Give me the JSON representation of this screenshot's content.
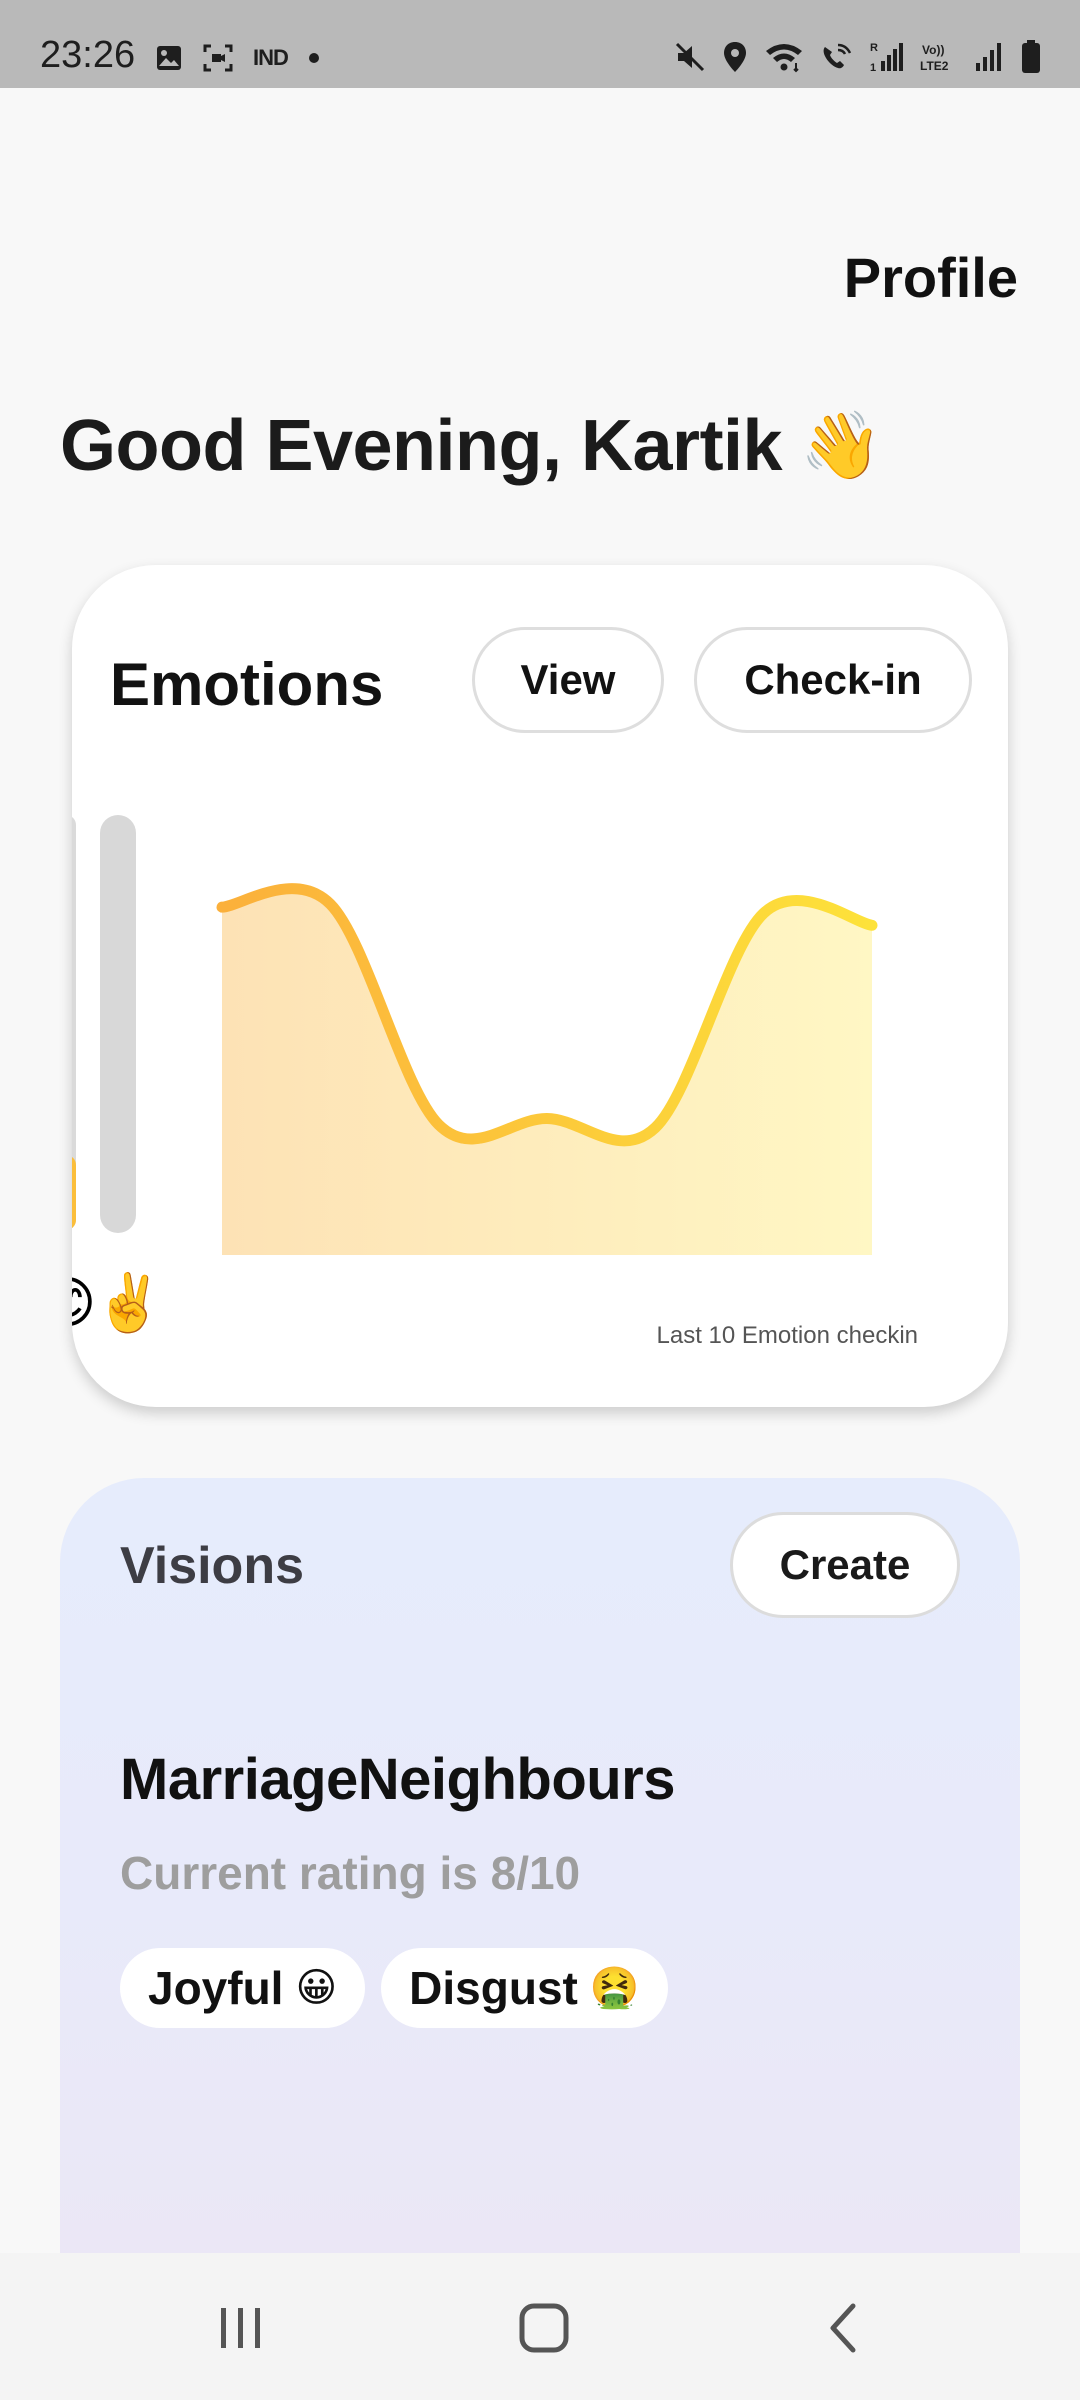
{
  "status_bar": {
    "time": "23:26",
    "left_icons": [
      "image-icon",
      "screen-record-icon",
      "ind-logo-icon",
      "dot-icon"
    ],
    "ind_label": "IND",
    "right_icons": [
      "mute-icon",
      "location-icon",
      "wifi-icon",
      "wifi-call-icon",
      "signal-1-icon",
      "volte-icon",
      "signal-2-icon",
      "battery-icon"
    ],
    "volte_label_1": "Vo))",
    "volte_label_2": "LTE2",
    "r_label": "R",
    "one_label": "1"
  },
  "header": {
    "profile_label": "Profile",
    "greeting": "Good Evening, Kartik",
    "greeting_emoji": "👋"
  },
  "emotions": {
    "title": "Emotions",
    "view_label": "View",
    "checkin_label": "Check-in",
    "partial_emoji": "😊",
    "peace_emoji": "✌️",
    "caption": "Last 10 Emotion checkin",
    "colors": {
      "line_start": "#fbb03b",
      "line_end": "#fde23a",
      "fill_start": "#fde2b5",
      "fill_end": "#fff7c4"
    },
    "trend_levels": [
      0.92,
      0.93,
      0.2,
      0.22,
      0.19,
      0.9,
      0.86
    ]
  },
  "visions": {
    "title": "Visions",
    "create_label": "Create",
    "vision_name": "MarriageNeighbours",
    "rating_text": "Current rating is 8/10",
    "tags": [
      {
        "label": "Joyful",
        "emoji": "😀"
      },
      {
        "label": "Disgust",
        "emoji": "🤮"
      }
    ]
  },
  "nav": {
    "icons": [
      "recent-apps-icon",
      "home-icon",
      "back-icon"
    ]
  }
}
